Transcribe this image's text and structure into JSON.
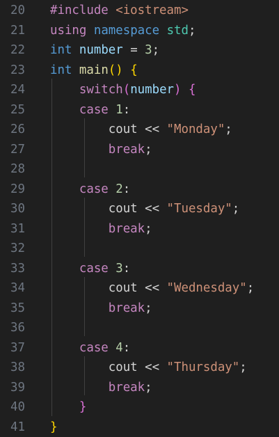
{
  "editor": {
    "lines": [
      {
        "num": "20",
        "tokens": [
          {
            "t": "#include ",
            "c": "t-dir"
          },
          {
            "t": "<iostream>",
            "c": "t-inc"
          }
        ]
      },
      {
        "num": "21",
        "tokens": [
          {
            "t": "using",
            "c": "t-ctrl"
          },
          {
            "t": " ",
            "c": "t-plain"
          },
          {
            "t": "namespace",
            "c": "t-kw"
          },
          {
            "t": " ",
            "c": "t-plain"
          },
          {
            "t": "std",
            "c": "t-ns"
          },
          {
            "t": ";",
            "c": "t-plain"
          }
        ]
      },
      {
        "num": "22",
        "tokens": [
          {
            "t": "int",
            "c": "t-kw"
          },
          {
            "t": " ",
            "c": "t-plain"
          },
          {
            "t": "number",
            "c": "t-var"
          },
          {
            "t": " = ",
            "c": "t-op"
          },
          {
            "t": "3",
            "c": "t-num"
          },
          {
            "t": ";",
            "c": "t-plain"
          }
        ]
      },
      {
        "num": "23",
        "tokens": [
          {
            "t": "int",
            "c": "t-kw"
          },
          {
            "t": " ",
            "c": "t-plain"
          },
          {
            "t": "main",
            "c": "t-fn"
          },
          {
            "t": "() ",
            "c": "t-br1"
          },
          {
            "t": "{",
            "c": "t-br1"
          }
        ]
      },
      {
        "num": "24",
        "tokens": [
          {
            "t": "    switch",
            "c": "t-ctrl"
          },
          {
            "t": "(",
            "c": "t-br2"
          },
          {
            "t": "number",
            "c": "t-var"
          },
          {
            "t": ")",
            "c": "t-br2"
          },
          {
            "t": " ",
            "c": "t-plain"
          },
          {
            "t": "{",
            "c": "t-br2"
          }
        ]
      },
      {
        "num": "25",
        "tokens": [
          {
            "t": "    case",
            "c": "t-ctrl"
          },
          {
            "t": " ",
            "c": "t-plain"
          },
          {
            "t": "1",
            "c": "t-num"
          },
          {
            "t": ":",
            "c": "t-plain"
          }
        ]
      },
      {
        "num": "26",
        "tokens": [
          {
            "t": "        cout",
            "c": "t-plain"
          },
          {
            "t": " << ",
            "c": "t-op"
          },
          {
            "t": "\"Monday\"",
            "c": "t-str"
          },
          {
            "t": ";",
            "c": "t-plain"
          }
        ]
      },
      {
        "num": "27",
        "tokens": [
          {
            "t": "        break",
            "c": "t-ctrl"
          },
          {
            "t": ";",
            "c": "t-plain"
          }
        ]
      },
      {
        "num": "28",
        "tokens": []
      },
      {
        "num": "29",
        "tokens": [
          {
            "t": "    case",
            "c": "t-ctrl"
          },
          {
            "t": " ",
            "c": "t-plain"
          },
          {
            "t": "2",
            "c": "t-num"
          },
          {
            "t": ":",
            "c": "t-plain"
          }
        ]
      },
      {
        "num": "30",
        "tokens": [
          {
            "t": "        cout",
            "c": "t-plain"
          },
          {
            "t": " << ",
            "c": "t-op"
          },
          {
            "t": "\"Tuesday\"",
            "c": "t-str"
          },
          {
            "t": ";",
            "c": "t-plain"
          }
        ]
      },
      {
        "num": "31",
        "tokens": [
          {
            "t": "        break",
            "c": "t-ctrl"
          },
          {
            "t": ";",
            "c": "t-plain"
          }
        ]
      },
      {
        "num": "32",
        "tokens": []
      },
      {
        "num": "33",
        "tokens": [
          {
            "t": "    case",
            "c": "t-ctrl"
          },
          {
            "t": " ",
            "c": "t-plain"
          },
          {
            "t": "3",
            "c": "t-num"
          },
          {
            "t": ":",
            "c": "t-plain"
          }
        ]
      },
      {
        "num": "34",
        "tokens": [
          {
            "t": "        cout",
            "c": "t-plain"
          },
          {
            "t": " << ",
            "c": "t-op"
          },
          {
            "t": "\"Wednesday\"",
            "c": "t-str"
          },
          {
            "t": ";",
            "c": "t-plain"
          }
        ]
      },
      {
        "num": "35",
        "tokens": [
          {
            "t": "        break",
            "c": "t-ctrl"
          },
          {
            "t": ";",
            "c": "t-plain"
          }
        ]
      },
      {
        "num": "36",
        "tokens": []
      },
      {
        "num": "37",
        "tokens": [
          {
            "t": "    case",
            "c": "t-ctrl"
          },
          {
            "t": " ",
            "c": "t-plain"
          },
          {
            "t": "4",
            "c": "t-num"
          },
          {
            "t": ":",
            "c": "t-plain"
          }
        ]
      },
      {
        "num": "38",
        "tokens": [
          {
            "t": "        cout",
            "c": "t-plain"
          },
          {
            "t": " << ",
            "c": "t-op"
          },
          {
            "t": "\"Thursday\"",
            "c": "t-str"
          },
          {
            "t": ";",
            "c": "t-plain"
          }
        ]
      },
      {
        "num": "39",
        "tokens": [
          {
            "t": "        break",
            "c": "t-ctrl"
          },
          {
            "t": ";",
            "c": "t-plain"
          }
        ]
      },
      {
        "num": "40",
        "tokens": [
          {
            "t": "    }",
            "c": "t-br2"
          }
        ]
      },
      {
        "num": "41",
        "tokens": [
          {
            "t": "}",
            "c": "t-br1"
          }
        ]
      }
    ]
  }
}
